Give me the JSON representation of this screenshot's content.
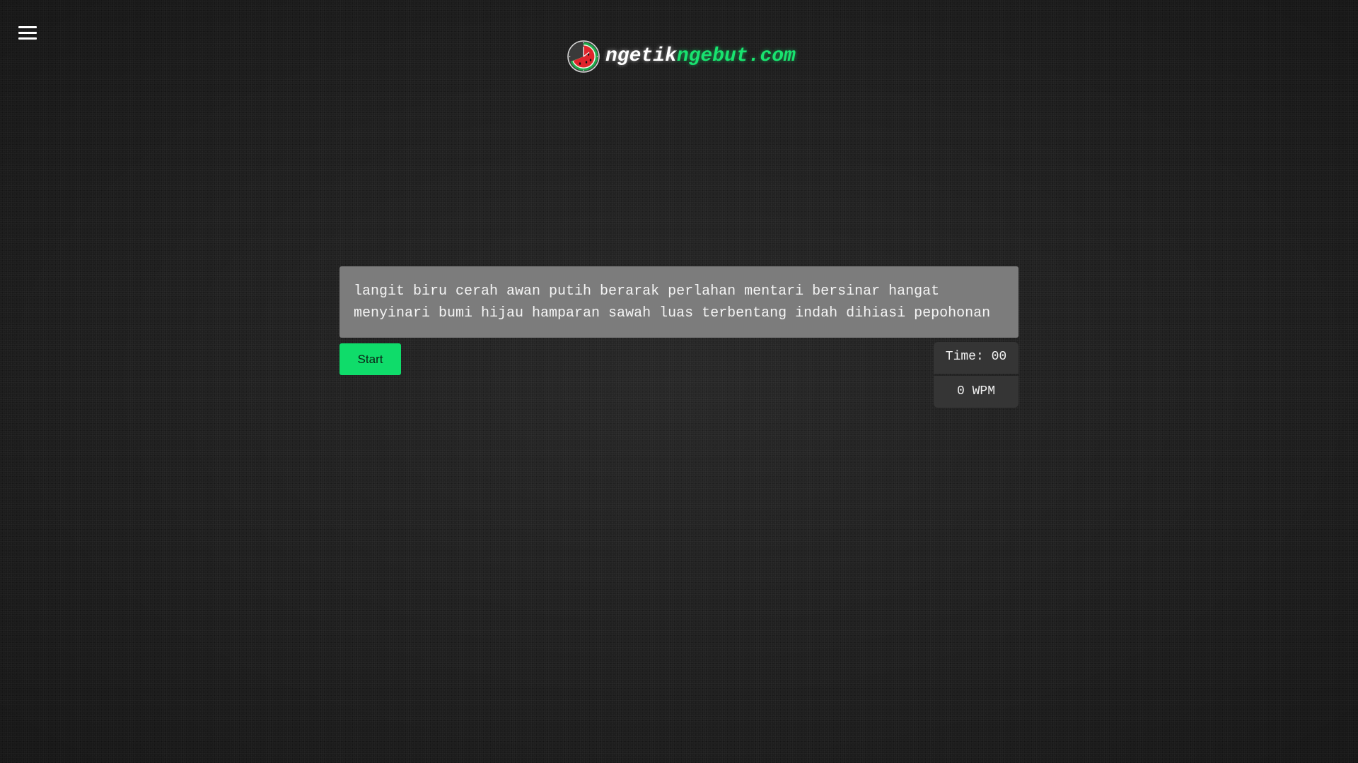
{
  "header": {
    "brand_part1": "ngetik",
    "brand_part2": "ngebut.com",
    "logo_icon": "watermelon-clock-icon",
    "menu_icon": "hamburger-menu-icon"
  },
  "typing": {
    "text": "langit biru cerah awan putih berarak perlahan mentari bersinar hangat menyinari bumi hijau hamparan sawah luas terbentang indah dihiasi pepohonan"
  },
  "controls": {
    "start_label": "Start"
  },
  "stats": {
    "time": "Time: 00",
    "wpm": "0 WPM"
  },
  "colors": {
    "accent": "#18e36f",
    "button": "#0fdc6a",
    "background": "#1f1f1f",
    "text_box": "#7c7c7c",
    "stat_box": "#353535"
  }
}
